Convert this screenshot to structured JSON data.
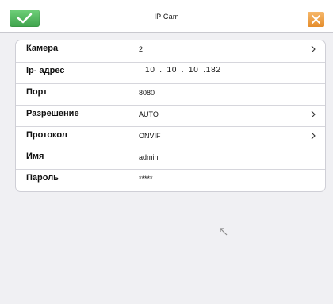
{
  "window": {
    "title": "IP Cam"
  },
  "icons": {
    "ok": "checkmark-icon",
    "close": "close-icon",
    "chevron": "chevron-right-icon",
    "cursor": "mouse-pointer-icon"
  },
  "colors": {
    "ok_button": "#4cae57",
    "close_button": "#ec9a3c",
    "background": "#f0f0f3"
  },
  "fields": [
    {
      "label": "Камера",
      "value": "2",
      "has_chevron": true
    },
    {
      "label": "Ip- адрес",
      "value": "10 . 10 . 10 .182",
      "has_chevron": false
    },
    {
      "label": "Порт",
      "value": "8080",
      "has_chevron": false
    },
    {
      "label": "Разрешение",
      "value": "AUTO",
      "has_chevron": true
    },
    {
      "label": "Протокол",
      "value": "ONVIF",
      "has_chevron": true
    },
    {
      "label": "Имя",
      "value": "admin",
      "has_chevron": false
    },
    {
      "label": "Пароль",
      "value": "*****",
      "has_chevron": false
    }
  ]
}
